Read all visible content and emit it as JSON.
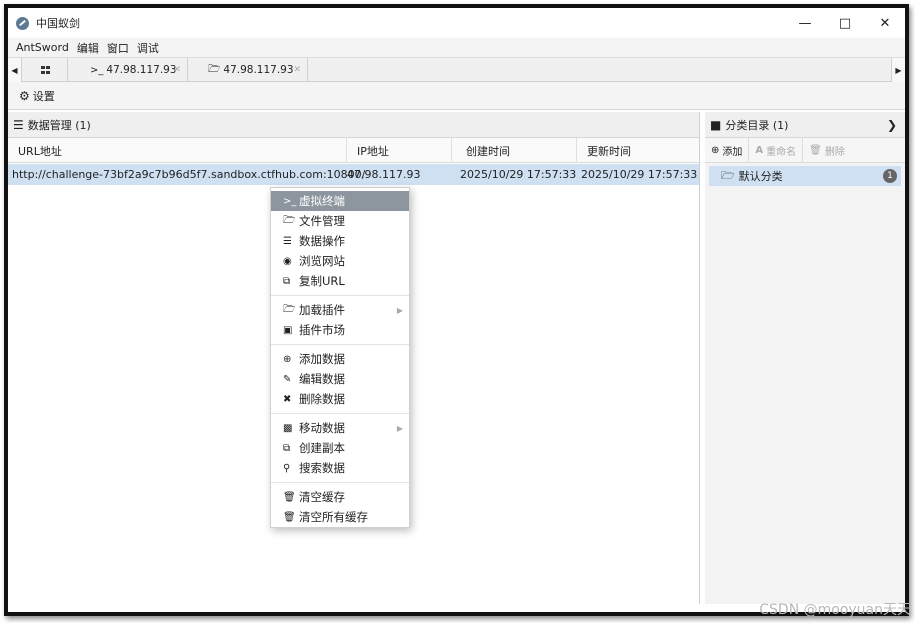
{
  "window": {
    "title": "中国蚁剑"
  },
  "menubar": {
    "items": [
      "AntSword",
      "编辑",
      "窗口",
      "调试"
    ]
  },
  "tabs": [
    {
      "icon": "terminal-icon",
      "label": "47.98.117.93"
    },
    {
      "icon": "folder-icon",
      "label": "47.98.117.93"
    }
  ],
  "toolbar": {
    "settings_label": "设置"
  },
  "data_panel": {
    "header": "数据管理 (1)",
    "columns": [
      "URL地址",
      "IP地址",
      "创建时间",
      "更新时间"
    ],
    "rows": [
      {
        "url": "http://challenge-73bf2a9c7b96d5f7.sandbox.ctfhub.com:10800/",
        "ip": "47.98.117.93",
        "created": "2025/10/29 17:57:33",
        "updated": "2025/10/29 17:57:33"
      }
    ]
  },
  "category_panel": {
    "header": "分类目录 (1)",
    "add_label": "添加",
    "rename_label": "重命名",
    "delete_label": "删除",
    "items": [
      {
        "label": "默认分类",
        "count": "1"
      }
    ]
  },
  "context_menu": {
    "items": [
      {
        "label": "虚拟终端",
        "icon": "terminal-icon"
      },
      {
        "label": "文件管理",
        "icon": "folder-icon"
      },
      {
        "label": "数据操作",
        "icon": "database-icon"
      },
      {
        "label": "浏览网站",
        "icon": "chrome-icon"
      },
      {
        "label": "复制URL",
        "icon": "copy-icon"
      },
      {
        "label": "加载插件",
        "icon": "folder-icon"
      },
      {
        "label": "插件市场",
        "icon": "cart-icon"
      },
      {
        "label": "添加数据",
        "icon": "plus-circle-icon"
      },
      {
        "label": "编辑数据",
        "icon": "edit-icon"
      },
      {
        "label": "删除数据",
        "icon": "close-icon"
      },
      {
        "label": "移动数据",
        "icon": "move-icon"
      },
      {
        "label": "创建副本",
        "icon": "copy-icon"
      },
      {
        "label": "搜索数据",
        "icon": "search-icon"
      },
      {
        "label": "清空缓存",
        "icon": "trash-outline-icon"
      },
      {
        "label": "清空所有缓存",
        "icon": "trash-icon"
      }
    ]
  },
  "watermark": "CSDN @mooyuan天天",
  "colors": {
    "selection": "#cfe0f3",
    "menu_active": "#8d959e"
  }
}
